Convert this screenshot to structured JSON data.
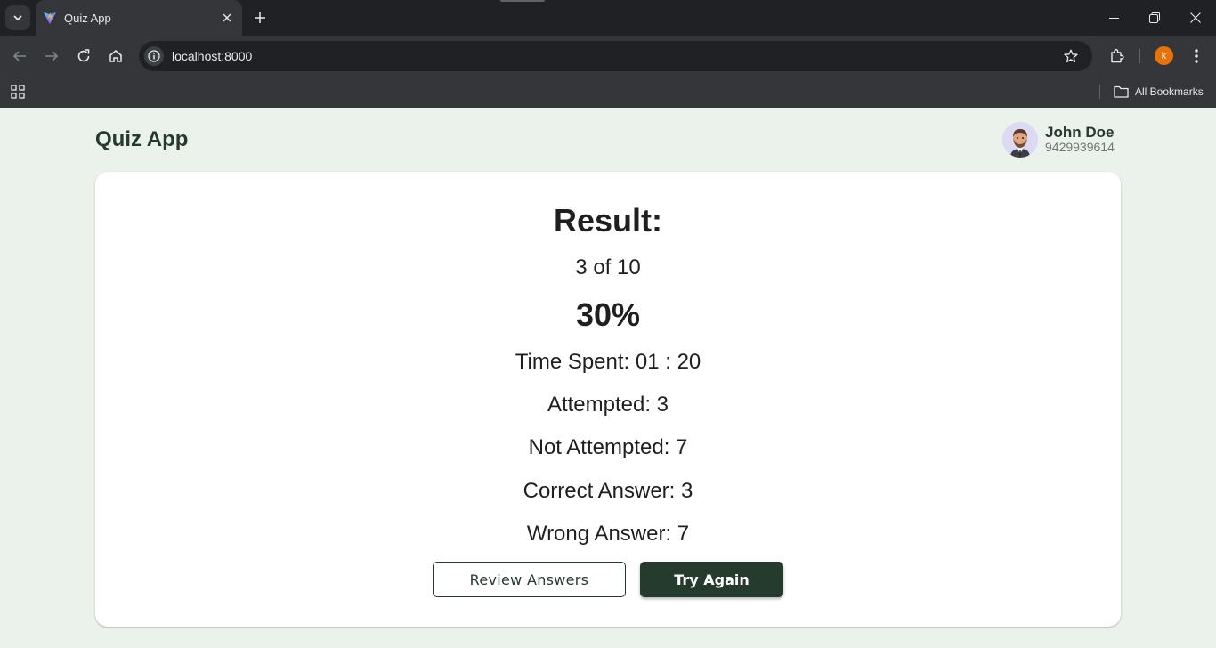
{
  "browser": {
    "tab_title": "Quiz App",
    "url": "localhost:8000",
    "profile_initial": "k",
    "bookmarks_label": "All Bookmarks"
  },
  "app": {
    "title": "Quiz App",
    "user": {
      "name": "John Doe",
      "phone": "9429939614"
    }
  },
  "result": {
    "heading": "Result:",
    "score_text": "3 of 10",
    "percentage": "30%",
    "time_spent": "Time Spent: 01 : 20",
    "attempted": "Attempted: 3",
    "not_attempted": "Not Attempted: 7",
    "correct": "Correct Answer: 3",
    "wrong": "Wrong Answer: 7"
  },
  "actions": {
    "review_label": "Review Answers",
    "try_again_label": "Try Again"
  },
  "colors": {
    "page_bg": "#ebf2eb",
    "brand_dark_green": "#243b2e",
    "card_bg": "#ffffff",
    "profile_orange": "#e8710a"
  },
  "icons": [
    "tab-list-icon",
    "vite-favicon-icon",
    "close-icon",
    "plus-icon",
    "minimize-icon",
    "restore-icon",
    "back-icon",
    "forward-icon",
    "reload-icon",
    "home-icon",
    "site-info-icon",
    "star-icon",
    "extensions-icon",
    "kebab-menu-icon",
    "apps-grid-icon",
    "folder-icon"
  ]
}
